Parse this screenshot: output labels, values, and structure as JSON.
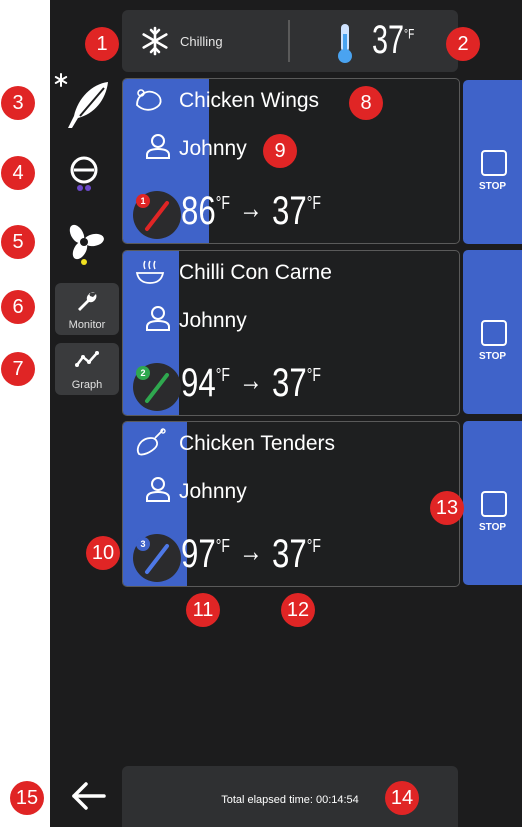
{
  "header": {
    "mode_label": "Chilling",
    "target_temp": "37",
    "temp_unit": "°F"
  },
  "sidebar": {
    "items": [
      {
        "icon": "feather-snowflake-icon"
      },
      {
        "icon": "compressor-icon"
      },
      {
        "icon": "fan-icon"
      },
      {
        "icon": "wrench-icon",
        "label": "Monitor"
      },
      {
        "icon": "graph-icon",
        "label": "Graph"
      }
    ]
  },
  "cards": [
    {
      "food_icon": "chicken-wing-icon",
      "name": "Chicken Wings",
      "user": "Johnny",
      "probe_number": "1",
      "probe_color": "#e02525",
      "current_temp": "86",
      "target_temp": "37",
      "unit": "°F",
      "arrow": "→",
      "progress_fraction": 0.26,
      "stop_label": "STOP"
    },
    {
      "food_icon": "chili-bowl-icon",
      "name": "Chilli Con Carne",
      "user": "Johnny",
      "probe_number": "2",
      "probe_color": "#2fa84f",
      "current_temp": "94",
      "target_temp": "37",
      "unit": "°F",
      "arrow": "→",
      "progress_fraction": 0.17,
      "stop_label": "STOP"
    },
    {
      "food_icon": "drumstick-icon",
      "name": "Chicken Tenders",
      "user": "Johnny",
      "probe_number": "3",
      "probe_color": "#3f63c9",
      "current_temp": "97",
      "target_temp": "37",
      "unit": "°F",
      "arrow": "→",
      "progress_fraction": 0.19,
      "stop_label": "STOP"
    }
  ],
  "footer": {
    "elapsed_label": "Total elapsed time: 00:14:54"
  },
  "annotations": [
    "1",
    "2",
    "3",
    "4",
    "5",
    "6",
    "7",
    "8",
    "9",
    "10",
    "11",
    "12",
    "13",
    "14",
    "15"
  ],
  "colors": {
    "accent": "#3f63c9",
    "background": "#1c1c1d",
    "marker": "#e02525"
  }
}
